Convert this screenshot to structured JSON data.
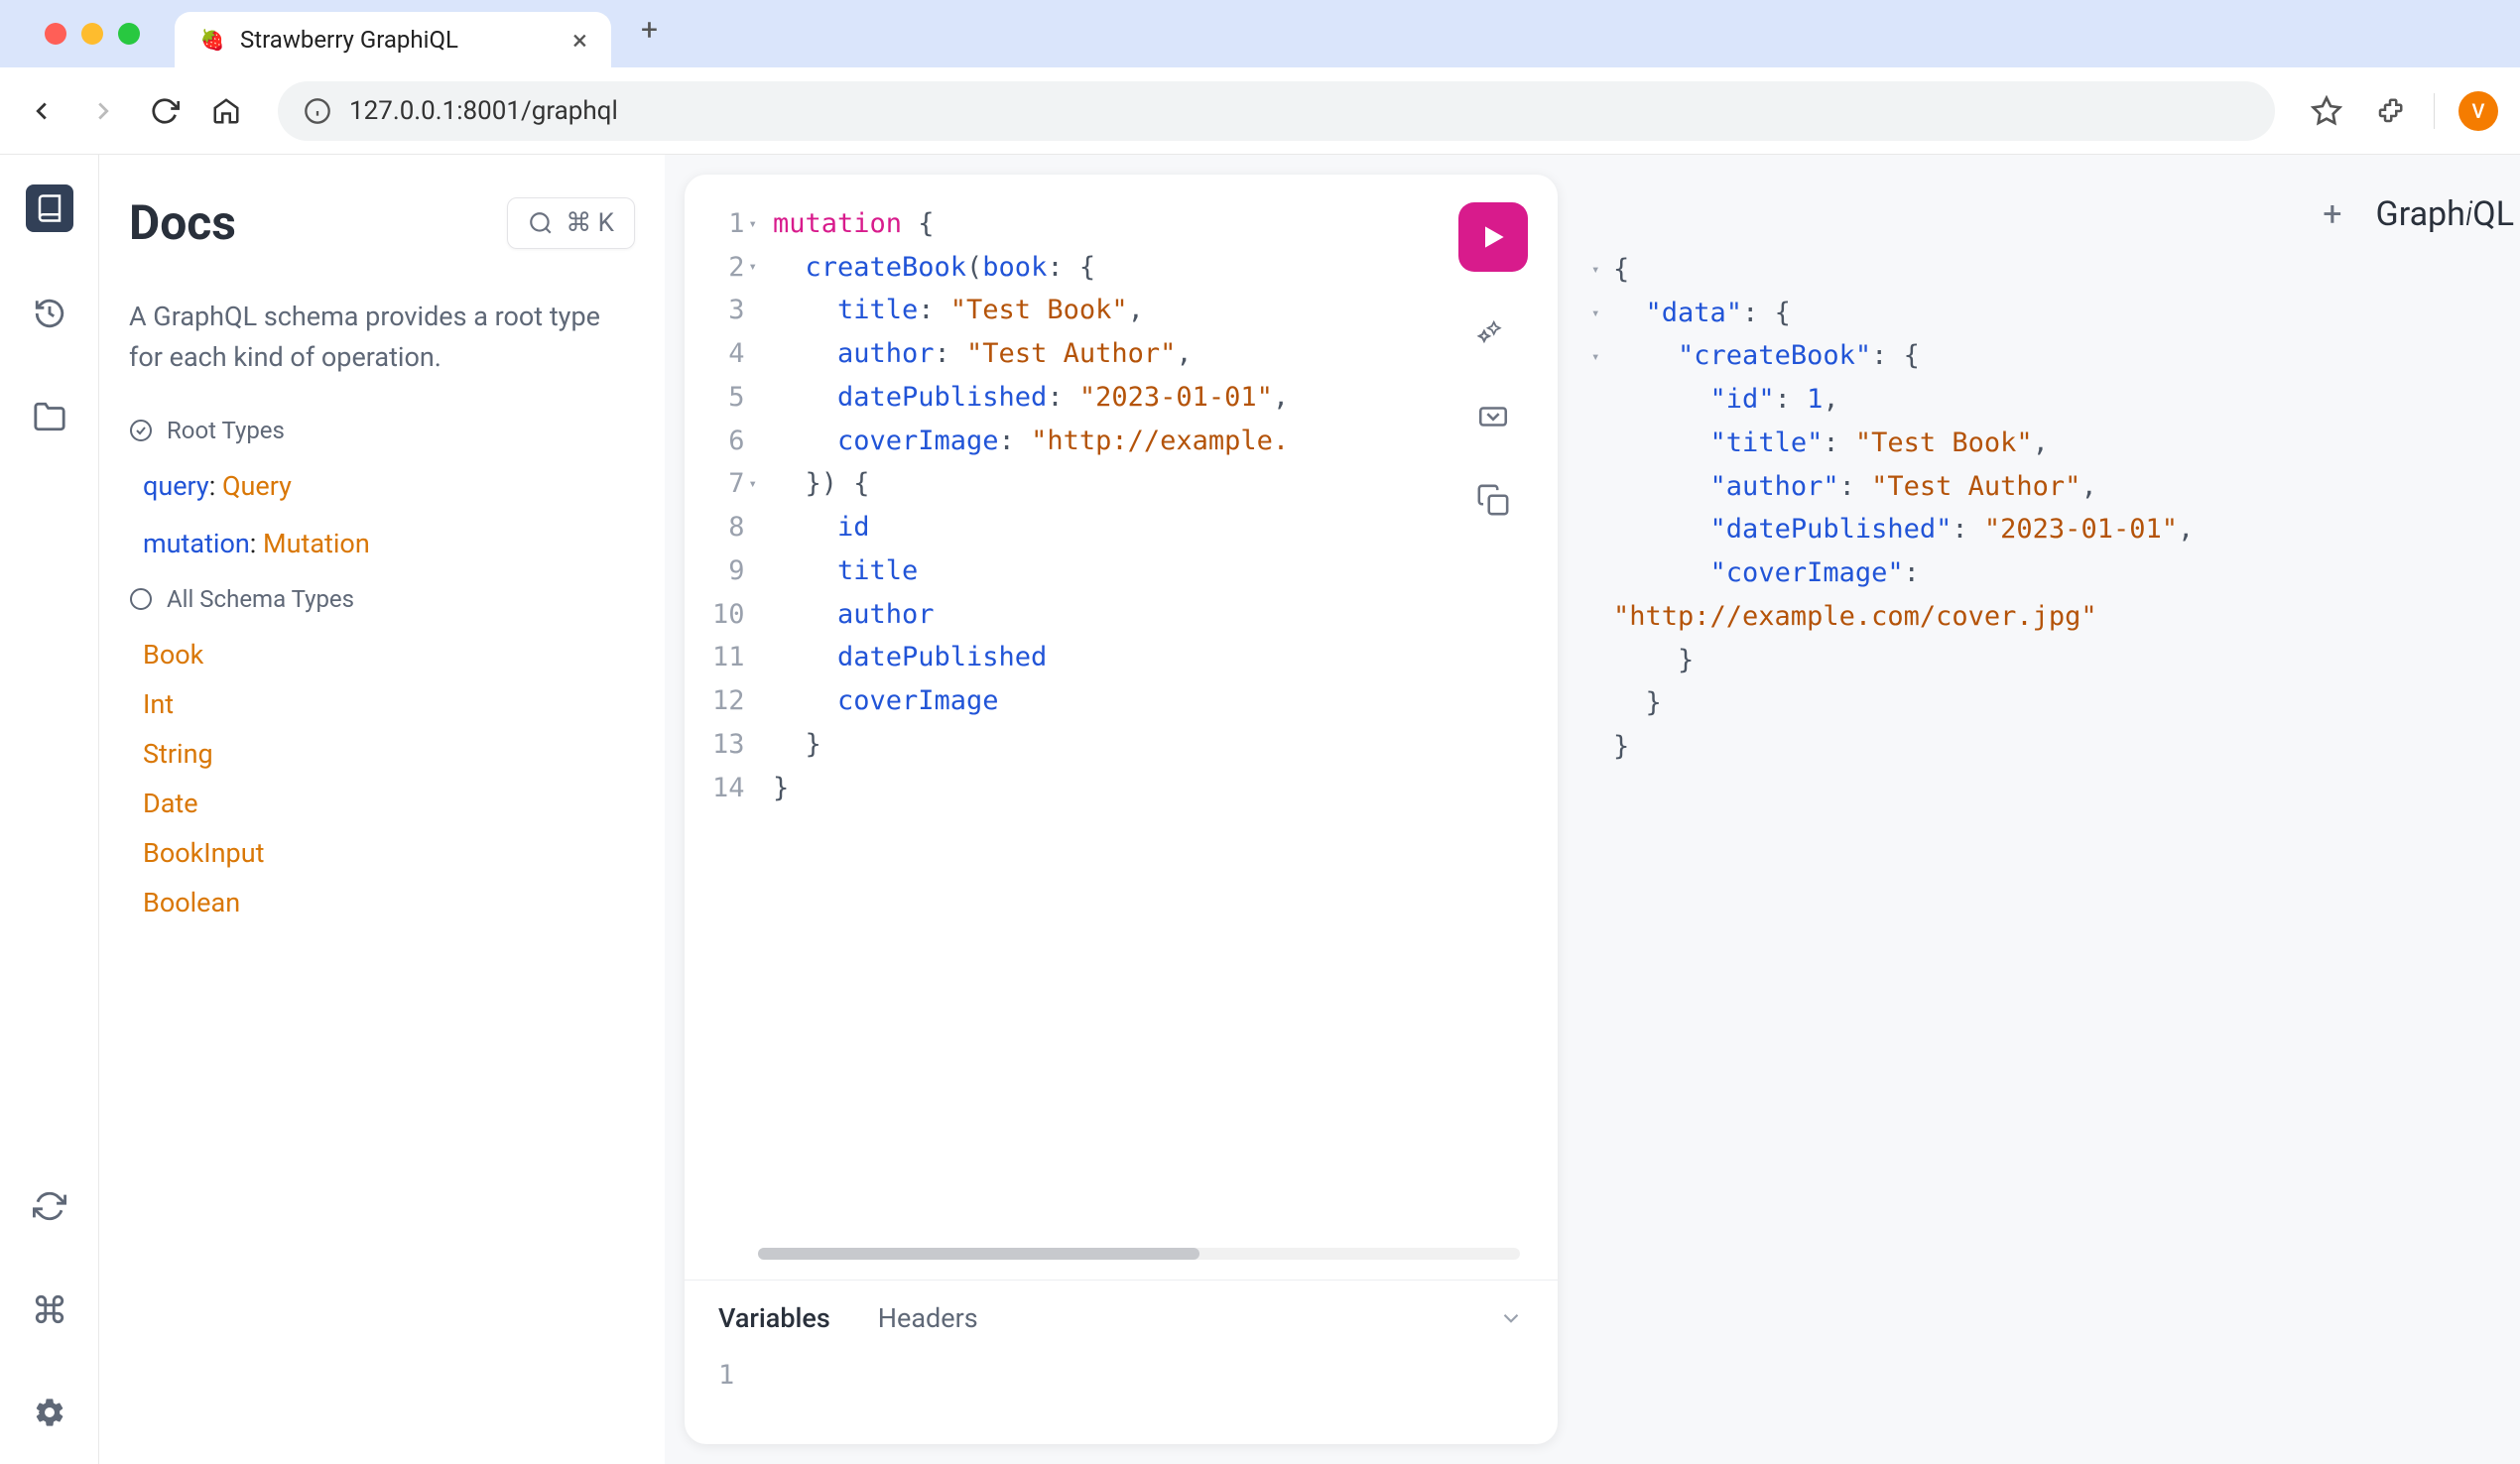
{
  "browser": {
    "tab_title": "Strawberry GraphiQL",
    "url": "127.0.0.1:8001/graphql",
    "avatar_initial": "V",
    "favicon": "🍓"
  },
  "docs": {
    "title": "Docs",
    "search_shortcut": "⌘ K",
    "description": "A GraphQL schema provides a root type for each kind of operation.",
    "root_types_header": "Root Types",
    "root_types": [
      {
        "key": "query",
        "type": "Query"
      },
      {
        "key": "mutation",
        "type": "Mutation"
      }
    ],
    "all_schema_types_header": "All Schema Types",
    "schema_types": [
      "Book",
      "Int",
      "String",
      "Date",
      "BookInput",
      "Boolean"
    ]
  },
  "editor": {
    "lines": [
      {
        "n": 1,
        "fold": "▾",
        "tokens": [
          [
            "keyword",
            "mutation"
          ],
          [
            "punc",
            " {"
          ]
        ]
      },
      {
        "n": 2,
        "fold": "▾",
        "tokens": [
          [
            "plain",
            "  "
          ],
          [
            "field",
            "createBook"
          ],
          [
            "punc",
            "("
          ],
          [
            "arg",
            "book"
          ],
          [
            "punc",
            ": {"
          ]
        ]
      },
      {
        "n": 3,
        "fold": "",
        "tokens": [
          [
            "plain",
            "    "
          ],
          [
            "prop",
            "title"
          ],
          [
            "punc",
            ": "
          ],
          [
            "string",
            "\"Test Book\""
          ],
          [
            "punc",
            ","
          ]
        ]
      },
      {
        "n": 4,
        "fold": "",
        "tokens": [
          [
            "plain",
            "    "
          ],
          [
            "prop",
            "author"
          ],
          [
            "punc",
            ": "
          ],
          [
            "string",
            "\"Test Author\""
          ],
          [
            "punc",
            ","
          ]
        ]
      },
      {
        "n": 5,
        "fold": "",
        "tokens": [
          [
            "plain",
            "    "
          ],
          [
            "prop",
            "datePublished"
          ],
          [
            "punc",
            ": "
          ],
          [
            "string",
            "\"2023-01-01\""
          ],
          [
            "punc",
            ","
          ]
        ]
      },
      {
        "n": 6,
        "fold": "",
        "tokens": [
          [
            "plain",
            "    "
          ],
          [
            "prop",
            "coverImage"
          ],
          [
            "punc",
            ": "
          ],
          [
            "string",
            "\"http://example."
          ]
        ]
      },
      {
        "n": 7,
        "fold": "▾",
        "tokens": [
          [
            "plain",
            "  "
          ],
          [
            "punc",
            "}) {"
          ]
        ]
      },
      {
        "n": 8,
        "fold": "",
        "tokens": [
          [
            "plain",
            "    "
          ],
          [
            "prop",
            "id"
          ]
        ]
      },
      {
        "n": 9,
        "fold": "",
        "tokens": [
          [
            "plain",
            "    "
          ],
          [
            "prop",
            "title"
          ]
        ]
      },
      {
        "n": 10,
        "fold": "",
        "tokens": [
          [
            "plain",
            "    "
          ],
          [
            "prop",
            "author"
          ]
        ]
      },
      {
        "n": 11,
        "fold": "",
        "tokens": [
          [
            "plain",
            "    "
          ],
          [
            "prop",
            "datePublished"
          ]
        ]
      },
      {
        "n": 12,
        "fold": "",
        "tokens": [
          [
            "plain",
            "    "
          ],
          [
            "prop",
            "coverImage"
          ]
        ]
      },
      {
        "n": 13,
        "fold": "",
        "tokens": [
          [
            "plain",
            "  "
          ],
          [
            "punc",
            "}"
          ]
        ]
      },
      {
        "n": 14,
        "fold": "",
        "tokens": [
          [
            "punc",
            "}"
          ]
        ]
      }
    ],
    "tabs": {
      "variables": "Variables",
      "headers": "Headers"
    },
    "vars_gutter_first": "1"
  },
  "response": {
    "logo_prefix": "Graph",
    "logo_i": "i",
    "logo_suffix": "QL",
    "lines": [
      {
        "fold": "▾",
        "indent": 0,
        "tokens": [
          [
            "punc",
            "{"
          ]
        ]
      },
      {
        "fold": "▾",
        "indent": 1,
        "tokens": [
          [
            "key",
            "\"data\""
          ],
          [
            "punc",
            ": {"
          ]
        ]
      },
      {
        "fold": "▾",
        "indent": 2,
        "tokens": [
          [
            "key",
            "\"createBook\""
          ],
          [
            "punc",
            ": {"
          ]
        ]
      },
      {
        "fold": "",
        "indent": 3,
        "tokens": [
          [
            "key",
            "\"id\""
          ],
          [
            "punc",
            ": "
          ],
          [
            "num",
            "1"
          ],
          [
            "punc",
            ","
          ]
        ]
      },
      {
        "fold": "",
        "indent": 3,
        "tokens": [
          [
            "key",
            "\"title\""
          ],
          [
            "punc",
            ": "
          ],
          [
            "str",
            "\"Test Book\""
          ],
          [
            "punc",
            ","
          ]
        ]
      },
      {
        "fold": "",
        "indent": 3,
        "tokens": [
          [
            "key",
            "\"author\""
          ],
          [
            "punc",
            ": "
          ],
          [
            "str",
            "\"Test Author\""
          ],
          [
            "punc",
            ","
          ]
        ]
      },
      {
        "fold": "",
        "indent": 3,
        "tokens": [
          [
            "key",
            "\"datePublished\""
          ],
          [
            "punc",
            ": "
          ],
          [
            "str",
            "\"2023-01-01\""
          ],
          [
            "punc",
            ","
          ]
        ]
      },
      {
        "fold": "",
        "indent": 3,
        "tokens": [
          [
            "key",
            "\"coverImage\""
          ],
          [
            "punc",
            ":"
          ]
        ]
      },
      {
        "fold": "",
        "indent": 0,
        "tokens": [
          [
            "str",
            "\"http://example.com/cover.jpg\""
          ]
        ]
      },
      {
        "fold": "",
        "indent": 2,
        "tokens": [
          [
            "punc",
            "}"
          ]
        ]
      },
      {
        "fold": "",
        "indent": 1,
        "tokens": [
          [
            "punc",
            "}"
          ]
        ]
      },
      {
        "fold": "",
        "indent": 0,
        "tokens": [
          [
            "punc",
            "}"
          ]
        ]
      }
    ]
  }
}
